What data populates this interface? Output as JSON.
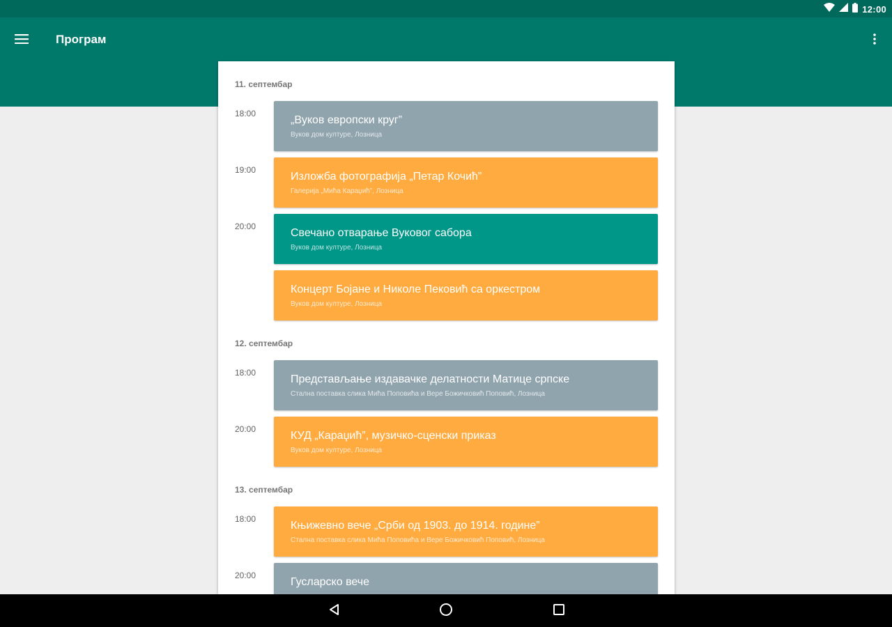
{
  "status_bar": {
    "time": "12:00",
    "icons": [
      "wifi-icon",
      "signal-icon",
      "battery-icon"
    ]
  },
  "app_bar": {
    "title": "Програм",
    "icons": [
      "menu-icon",
      "more-vert-icon"
    ]
  },
  "colors": {
    "primary": "#00796b",
    "primary_dark": "#00695c",
    "event_gray": "#90a4ae",
    "event_orange": "#ffab40",
    "event_teal": "#009688"
  },
  "schedule": [
    {
      "date": "11. септембар",
      "slots": [
        {
          "time": "18:00",
          "events": [
            {
              "title": "„Вуков европски круг”",
              "place": "Вуков дом културе, Лозница",
              "color": "gray"
            }
          ]
        },
        {
          "time": "19:00",
          "events": [
            {
              "title": "Изложба фотографија „Петар Кочић”",
              "place": "Галерија „Мића Караџић”, Лозница",
              "color": "orange"
            }
          ]
        },
        {
          "time": "20:00",
          "events": [
            {
              "title": "Свечано отварање Вуковог сабора",
              "place": "Вуков дом културе, Лозница",
              "color": "teal"
            },
            {
              "title": "Концерт Бојане и Николе Пековић са оркестром",
              "place": "Вуков дом културе, Лозница",
              "color": "orange"
            }
          ]
        }
      ]
    },
    {
      "date": "12. септембар",
      "slots": [
        {
          "time": "18:00",
          "events": [
            {
              "title": "Представљање издавачке делатности Матице српске",
              "place": "Стална поставка слика Мића Поповића и Вере Божичковић Поповић, Лозница",
              "color": "gray"
            }
          ]
        },
        {
          "time": "20:00",
          "events": [
            {
              "title": "КУД „Караџић”, музичко-сценски приказ",
              "place": "Вуков дом културе, Лозница",
              "color": "orange"
            }
          ]
        }
      ]
    },
    {
      "date": "13. септембар",
      "slots": [
        {
          "time": "18:00",
          "events": [
            {
              "title": "Књижевно вече „Срби од 1903. до 1914. године”",
              "place": "Стална поставка слика Мића Поповића и Вере Божичковић Поповић, Лозница",
              "color": "orange"
            }
          ]
        },
        {
          "time": "20:00",
          "events": [
            {
              "title": "Гусларско вече",
              "place": "",
              "color": "gray"
            }
          ]
        }
      ]
    }
  ],
  "nav_bar": {
    "icons": [
      "back-icon",
      "home-icon",
      "recents-icon"
    ]
  }
}
